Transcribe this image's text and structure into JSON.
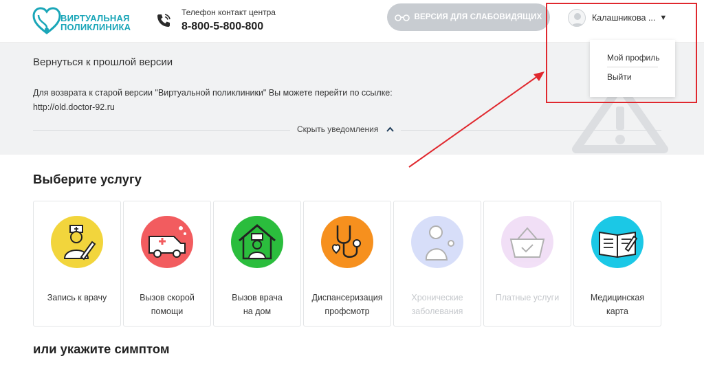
{
  "header": {
    "logo_line1": "ВИРТУАЛЬНАЯ",
    "logo_line2": "ПОЛИКЛИНИКА",
    "phone_label": "Телефон контакт центра",
    "phone_number": "8-800-5-800-800",
    "vision_button": "ВЕРСИЯ ДЛЯ СЛАБОВИДЯЩИХ",
    "user_name": "Калашникова ...",
    "user_caret": "▼"
  },
  "user_menu": {
    "items": [
      "Мой профиль",
      "Выйти"
    ]
  },
  "notice": {
    "title": "Вернуться к прошлой версии",
    "text": "Для возврата к старой версии \"Виртуальной поликлиники\" Вы можете перейти по ссылке:",
    "link": "http://old.doctor-92.ru",
    "hide_label": "Скрыть уведомления"
  },
  "services": {
    "title": "Выберите услугу",
    "cards": [
      {
        "line1": "Запись к врачу",
        "line2": "",
        "color": "#f2d53c",
        "enabled": true
      },
      {
        "line1": "Вызов скорой",
        "line2": "помощи",
        "color": "#f25c5f",
        "enabled": true
      },
      {
        "line1": "Вызов врача",
        "line2": "на дом",
        "color": "#2bbd3d",
        "enabled": true
      },
      {
        "line1": "Диспансеризация",
        "line2": "профсмотр",
        "color": "#f6901e",
        "enabled": true
      },
      {
        "line1": "Хронические",
        "line2": "заболевания",
        "color": "#8fa3f0",
        "enabled": false
      },
      {
        "line1": "Платные услуги",
        "line2": "",
        "color": "#d9a5e8",
        "enabled": false
      },
      {
        "line1": "Медицинская",
        "line2": "карта",
        "color": "#1bc8e6",
        "enabled": true
      }
    ]
  },
  "symptom": {
    "title": "или укажите симптом"
  },
  "colors": {
    "accent": "#1aa6b8",
    "highlight": "#e0282e",
    "button_disabled": "#c8ccd1"
  }
}
